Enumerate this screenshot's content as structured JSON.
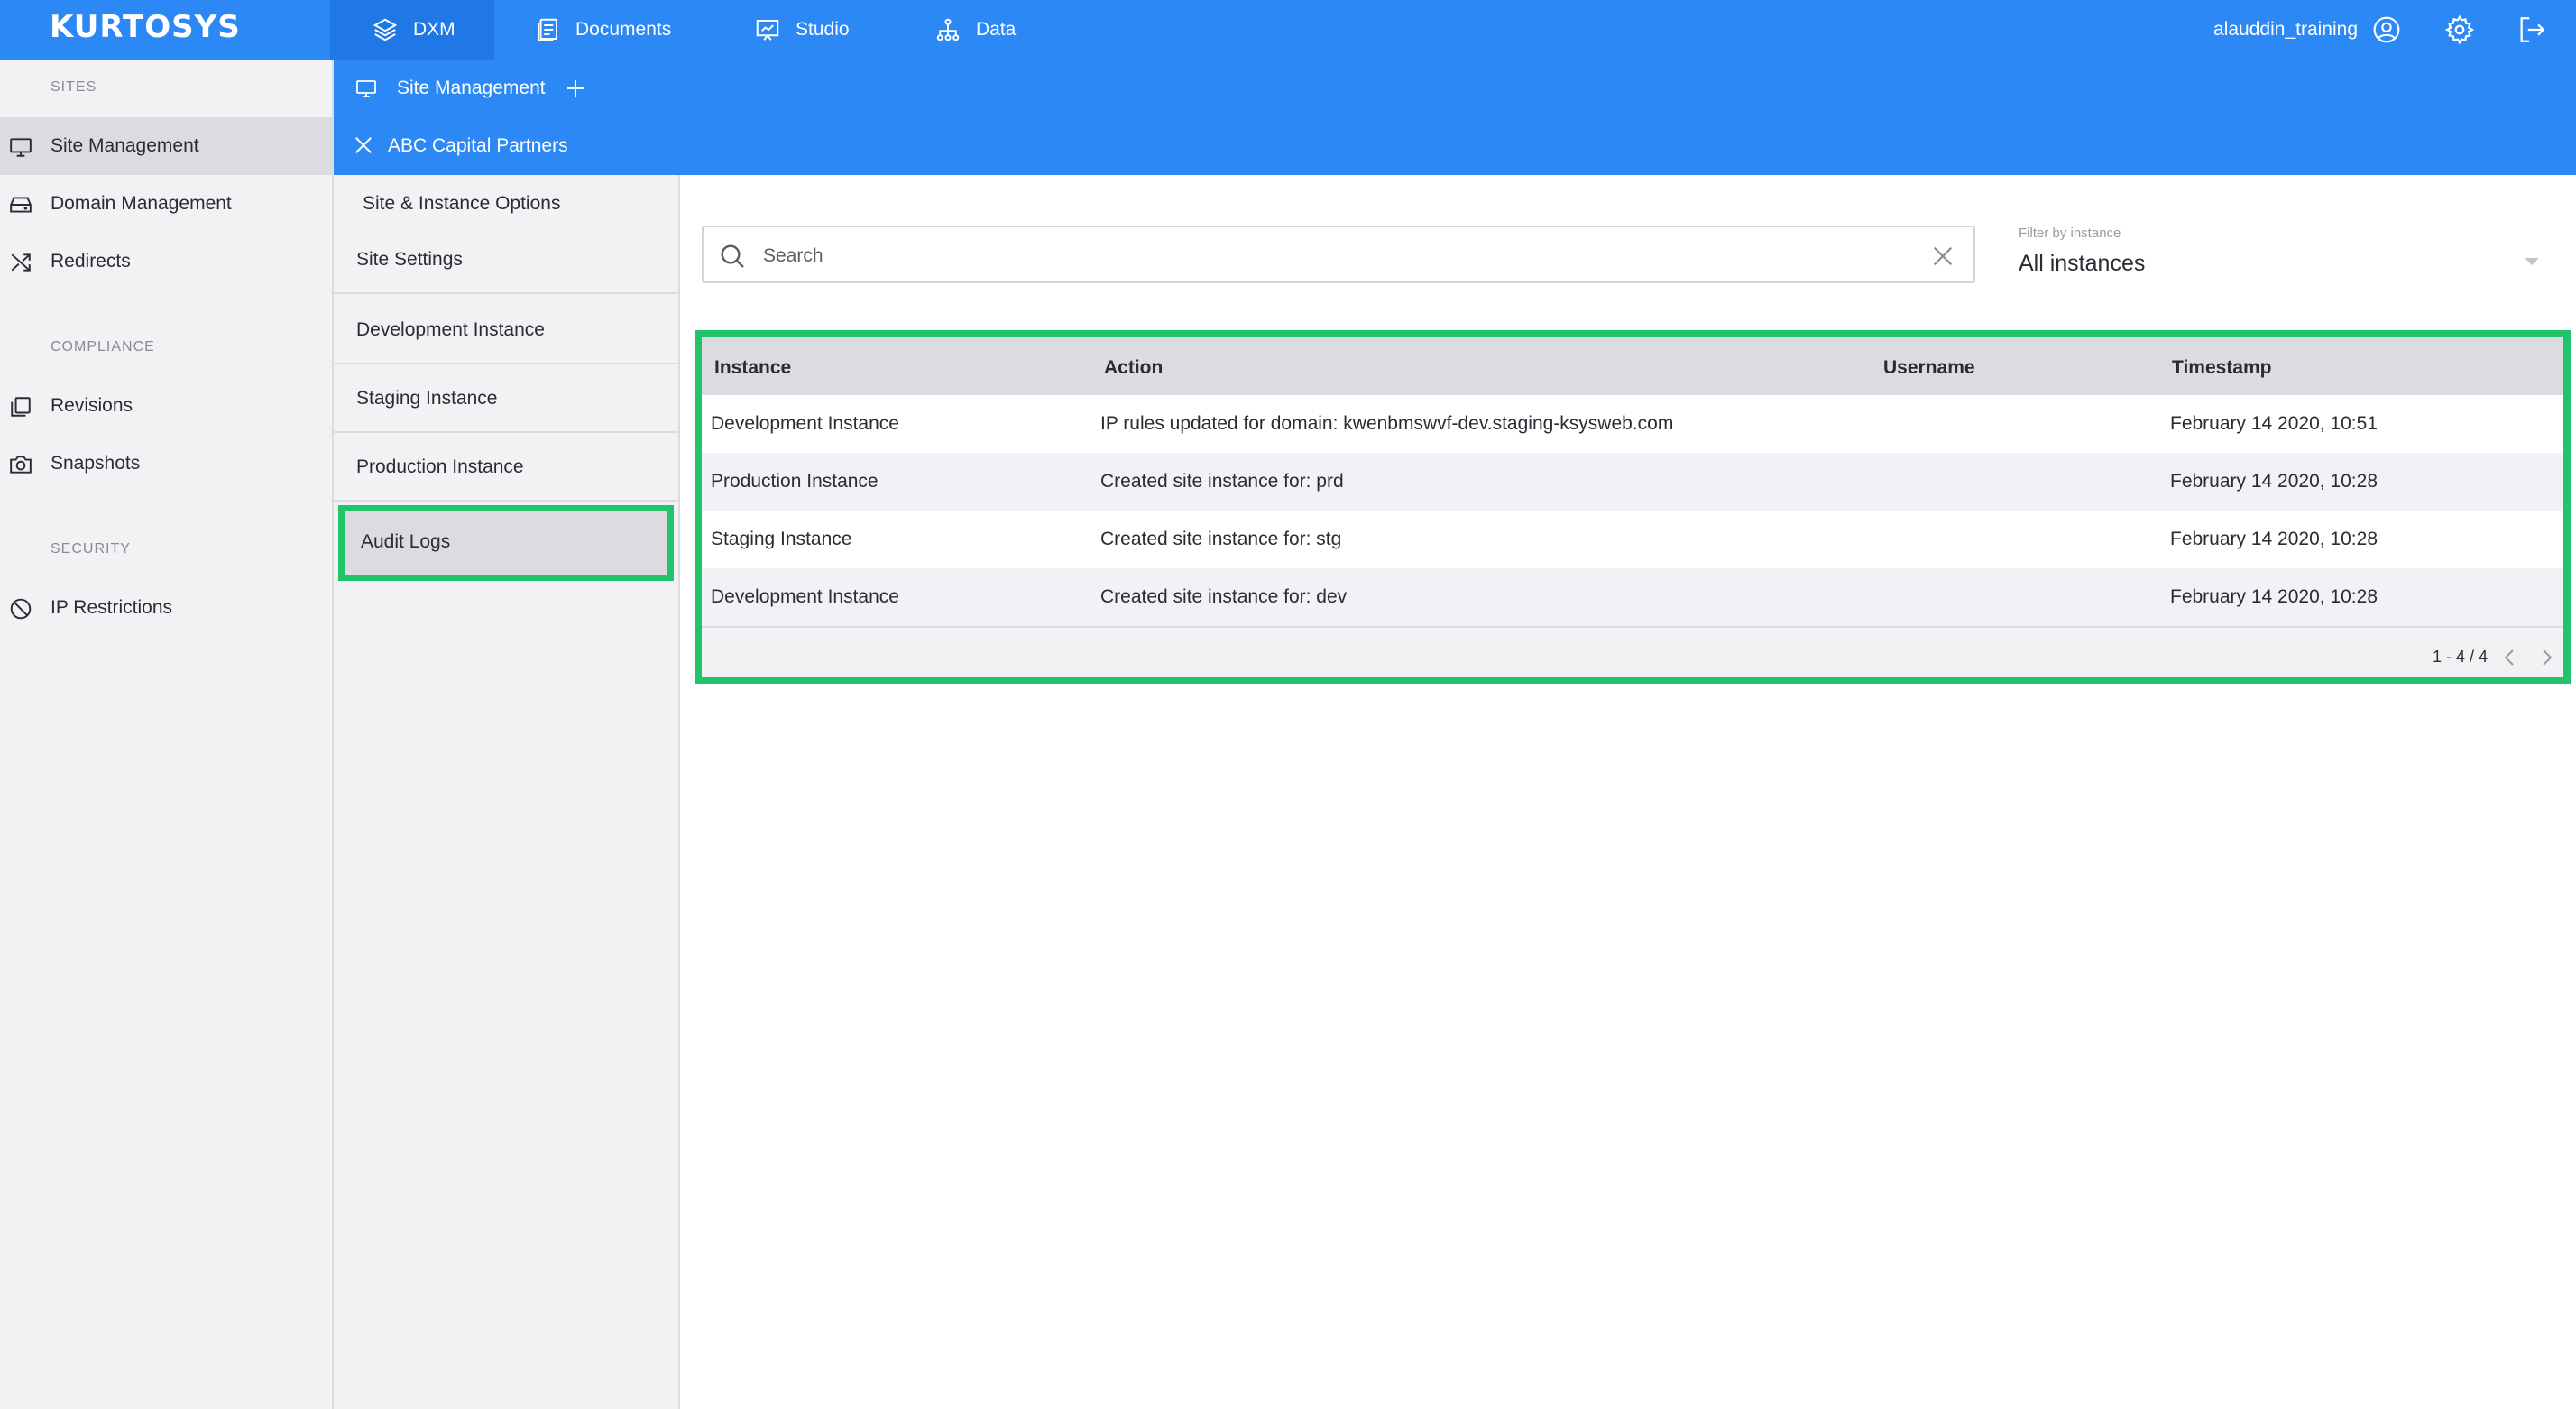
{
  "app": {
    "logo": "KURTOSYS",
    "nav": [
      {
        "label": "DXM",
        "icon": "layers-icon"
      },
      {
        "label": "Documents",
        "icon": "documents-icon"
      },
      {
        "label": "Studio",
        "icon": "presentation-icon"
      },
      {
        "label": "Data",
        "icon": "hierarchy-icon"
      }
    ],
    "user": "alauddin_training"
  },
  "sidebar": {
    "sections": [
      {
        "title": "SITES",
        "items": [
          {
            "label": "Site Management",
            "icon": "monitor-icon",
            "active": true
          },
          {
            "label": "Domain Management",
            "icon": "hard-drive-icon"
          },
          {
            "label": "Redirects",
            "icon": "shuffle-icon"
          }
        ]
      },
      {
        "title": "COMPLIANCE",
        "items": [
          {
            "label": "Revisions",
            "icon": "copy-icon"
          },
          {
            "label": "Snapshots",
            "icon": "camera-icon"
          }
        ]
      },
      {
        "title": "SECURITY",
        "items": [
          {
            "label": "IP Restrictions",
            "icon": "block-icon"
          }
        ]
      }
    ]
  },
  "crumb": {
    "label": "Site Management"
  },
  "site": {
    "name": "ABC Capital Partners"
  },
  "sitemenu": {
    "header": "Site & Instance Options",
    "items": [
      "Site Settings",
      "Development Instance",
      "Staging Instance",
      "Production Instance",
      "Audit Logs"
    ]
  },
  "search": {
    "placeholder": "Search"
  },
  "filter": {
    "label": "Filter by instance",
    "value": "All instances"
  },
  "table": {
    "columns": [
      "Instance",
      "Action",
      "Username",
      "Timestamp"
    ],
    "rows": [
      {
        "instance": "Development Instance",
        "action": "IP rules updated for domain: kwenbmswvf-dev.staging-ksysweb.com",
        "username": "",
        "timestamp": "February 14 2020, 10:51"
      },
      {
        "instance": "Production Instance",
        "action": "Created site instance for: prd",
        "username": "",
        "timestamp": "February 14 2020, 10:28"
      },
      {
        "instance": "Staging Instance",
        "action": "Created site instance for: stg",
        "username": "",
        "timestamp": "February 14 2020, 10:28"
      },
      {
        "instance": "Development Instance",
        "action": "Created site instance for: dev",
        "username": "",
        "timestamp": "February 14 2020, 10:28"
      }
    ],
    "pagination": "1 - 4 / 4"
  }
}
